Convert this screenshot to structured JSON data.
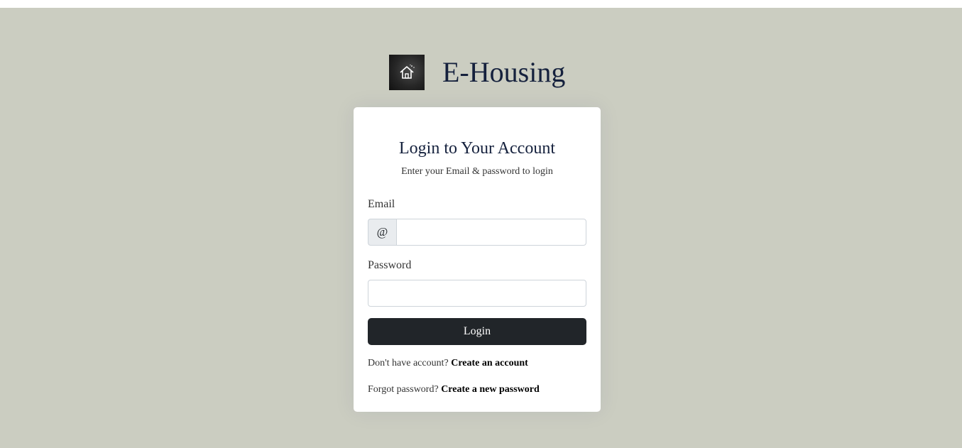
{
  "brand": {
    "name": "E-Housing",
    "logo_icon": "house-icon"
  },
  "login": {
    "title": "Login to Your Account",
    "subtitle": "Enter your Email & password to login",
    "email_label": "Email",
    "email_prefix": "@",
    "email_value": "",
    "password_label": "Password",
    "password_value": "",
    "button_label": "Login"
  },
  "links": {
    "register_prompt": "Don't have account?",
    "register_link": "Create an account",
    "forgot_prompt": "Forgot password?",
    "forgot_link": "Create a new password"
  },
  "colors": {
    "page_background": "#cbcdc1",
    "button_background": "#212529",
    "title_text": "#15213d"
  }
}
